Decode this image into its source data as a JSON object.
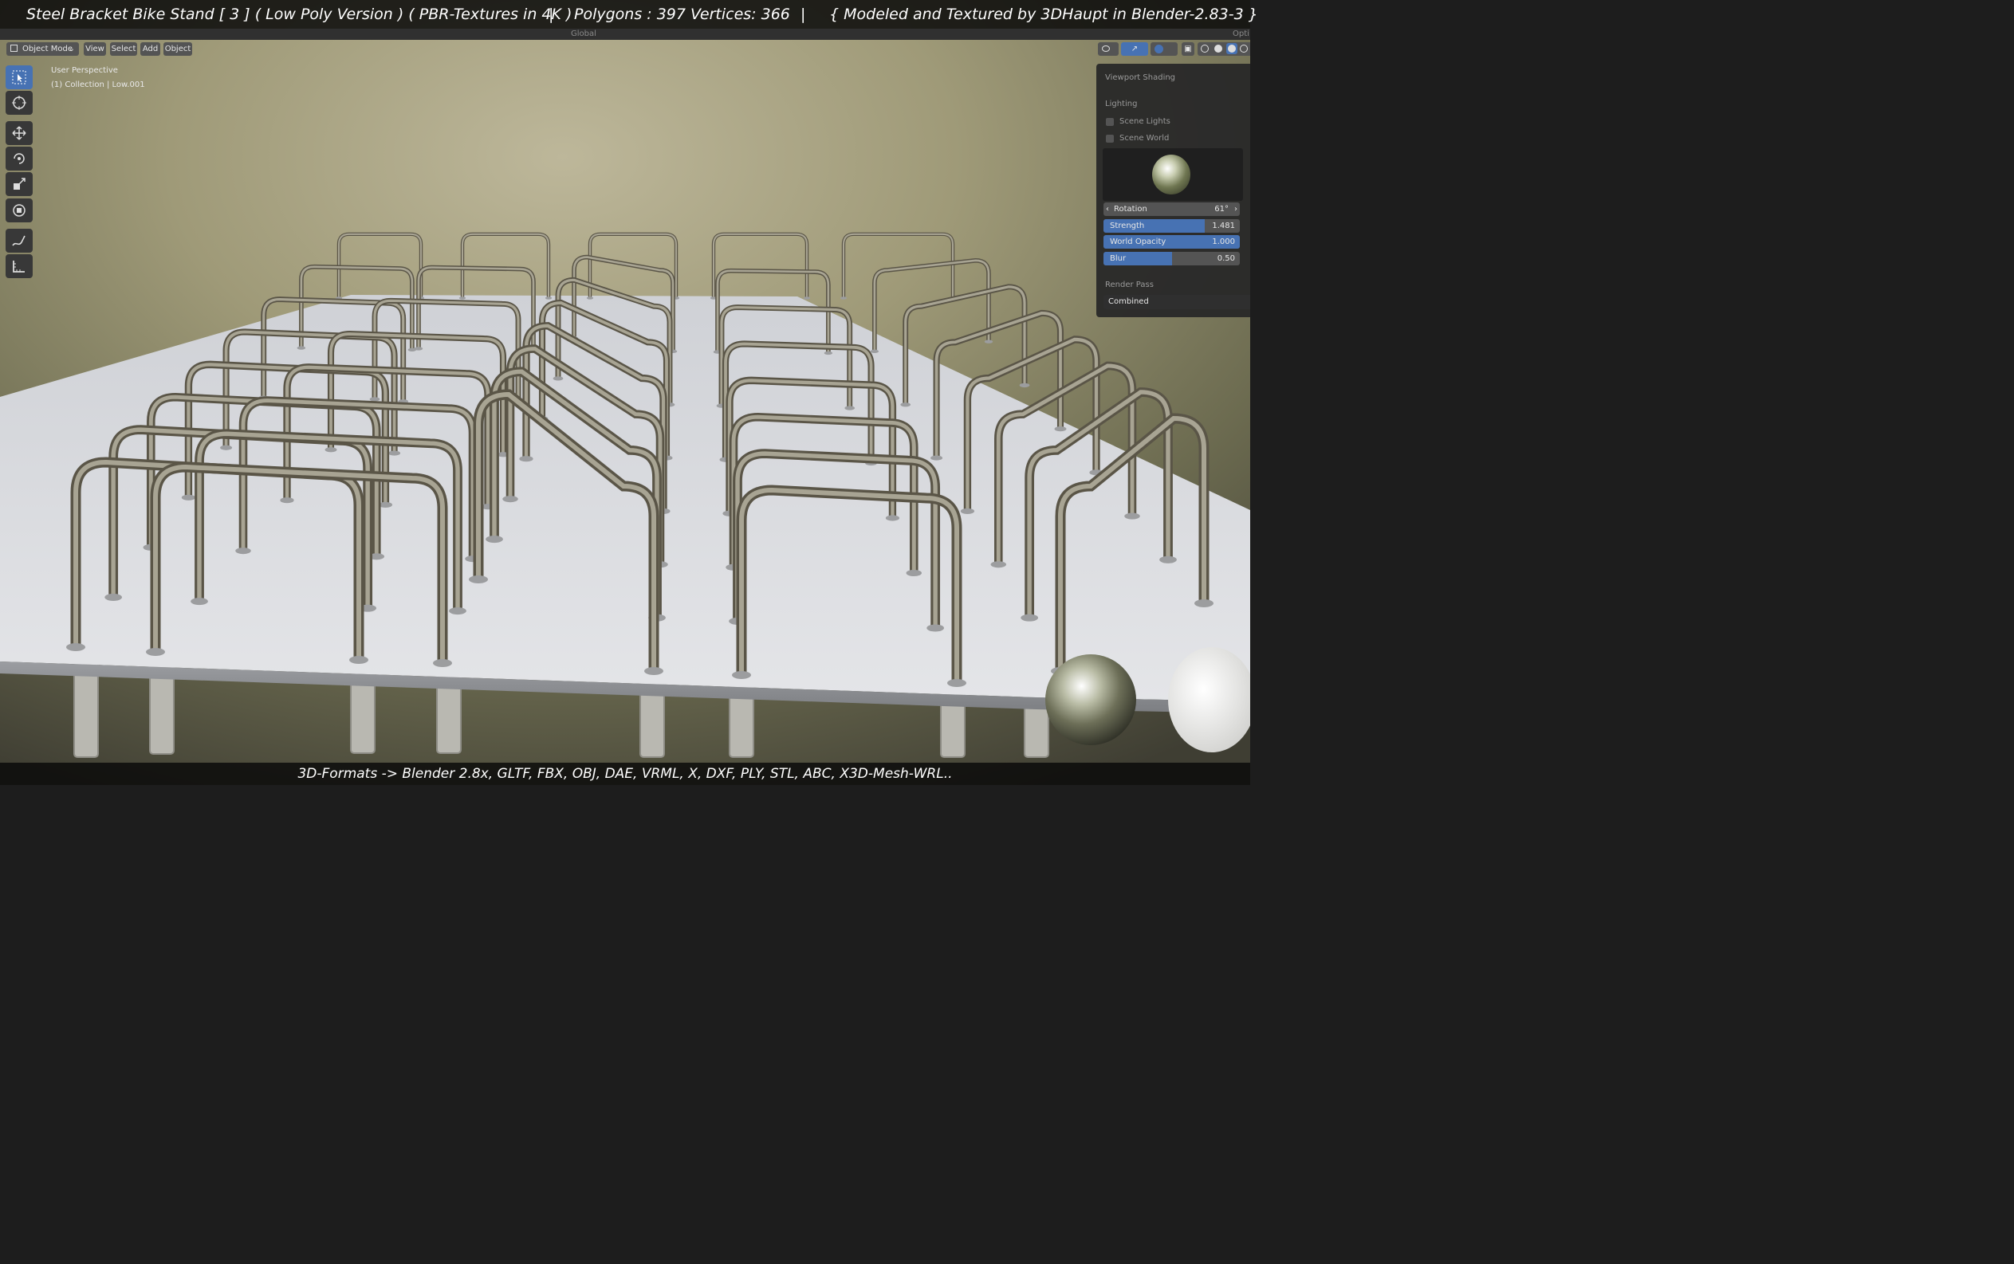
{
  "banner": {
    "title": "Steel Bracket Bike Stand [ 3 ] ( Low Poly Version ) ( PBR-Textures in 4K )",
    "sep1": "|",
    "stats": "Polygons : 397  Vertices: 366",
    "sep2": "|",
    "credit": "{ Modeled and Textured by 3DHaupt in Blender-2.83-3 }"
  },
  "header": {
    "transform_orientation": "Global",
    "options_label": "Opti",
    "mode": "Object Mode",
    "menus": [
      "View",
      "Select",
      "Add",
      "Object"
    ]
  },
  "viewport": {
    "perspective": "User Perspective",
    "collection": "(1) Collection | Low.001"
  },
  "shading_panel": {
    "title": "Viewport Shading",
    "lighting_label": "Lighting",
    "scene_lights": "Scene Lights",
    "scene_world": "Scene World",
    "rotation": {
      "label": "Rotation",
      "value": "61°"
    },
    "strength": {
      "label": "Strength",
      "value": "1.481",
      "fraction": 0.74
    },
    "world_opacity": {
      "label": "World Opacity",
      "value": "1.000",
      "fraction": 1.0
    },
    "blur": {
      "label": "Blur",
      "value": "0.50",
      "fraction": 0.5
    },
    "render_pass_label": "Render Pass",
    "render_pass_value": "Combined"
  },
  "footer": {
    "formats": "3D-Formats -> Blender 2.8x, GLTF, FBX, OBJ, DAE, VRML, X, DXF, PLY, STL, ABC, X3D-Mesh-WRL.."
  },
  "colors": {
    "accent": "#4772b3",
    "panel": "#282828",
    "button": "#545454",
    "floor": "#d8dadd"
  },
  "icons": [
    "select-box-icon",
    "cursor-icon",
    "move-icon",
    "rotate-icon",
    "scale-icon",
    "transform-icon",
    "annotate-icon",
    "measure-icon"
  ]
}
